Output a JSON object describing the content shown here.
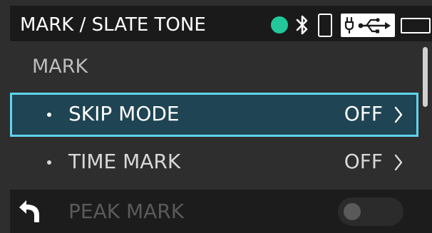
{
  "header": {
    "title": "MARK / SLATE TONE",
    "icons": {
      "record_status": "record-status-dot-icon",
      "bluetooth": "bluetooth-icon",
      "phone": "phone-icon",
      "power_source": "usb-power-icon",
      "battery": "battery-icon"
    },
    "record_status_color": "#22c89a"
  },
  "section": {
    "label": "MARK"
  },
  "items": [
    {
      "label": "SKIP MODE",
      "value": "OFF",
      "selected": true
    },
    {
      "label": "TIME MARK",
      "value": "OFF",
      "selected": false
    },
    {
      "label": "PEAK MARK",
      "toggle": false,
      "disabled": true
    }
  ],
  "footer": {
    "back_icon": "back-arrow-icon"
  },
  "colors": {
    "selection_border": "#5fd3ee",
    "selection_fill": "#1f4453"
  }
}
